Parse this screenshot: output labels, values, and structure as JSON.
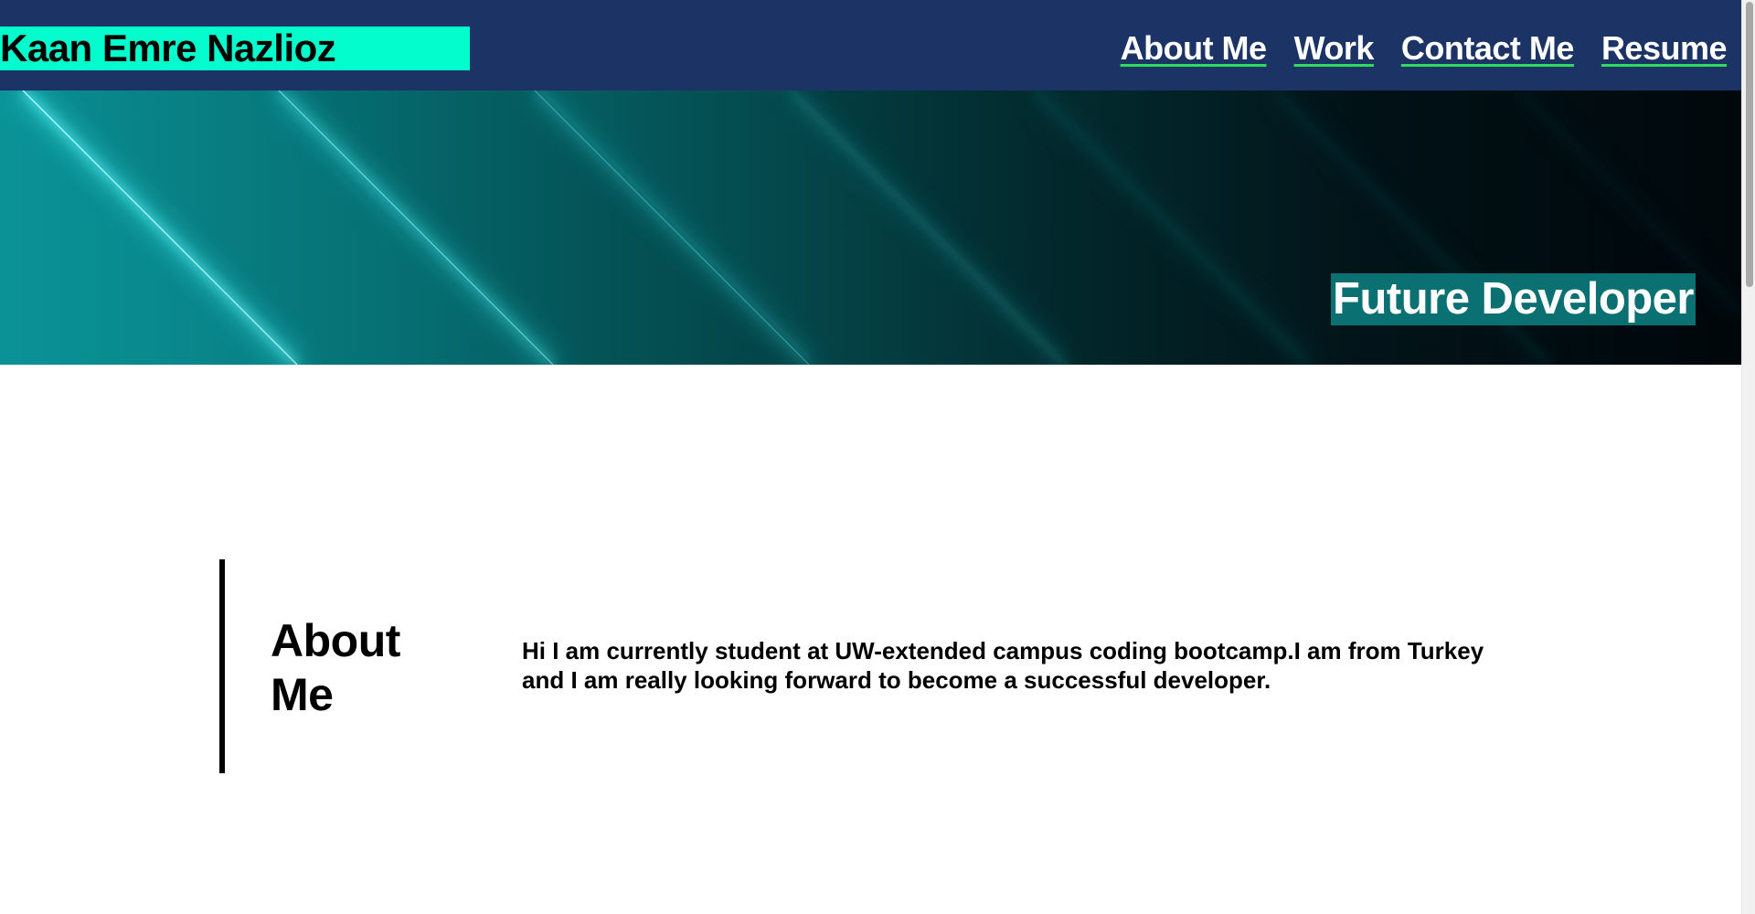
{
  "header": {
    "brand": "Kaan Emre Nazlioz",
    "nav": [
      {
        "label": "About Me"
      },
      {
        "label": "Work"
      },
      {
        "label": "Contact Me"
      },
      {
        "label": "Resume"
      }
    ]
  },
  "hero": {
    "tagline": "Future Developer"
  },
  "about": {
    "title": "About Me",
    "text": "Hi I am currently student at UW-extended campus coding bootcamp.I am from Turkey and I am really looking forward to become a successful developer."
  },
  "colors": {
    "header_bg": "#1b3365",
    "brand_bg": "#03fdcc",
    "nav_underline": "#2edb5a",
    "tagline_bg": "#0a7072"
  }
}
